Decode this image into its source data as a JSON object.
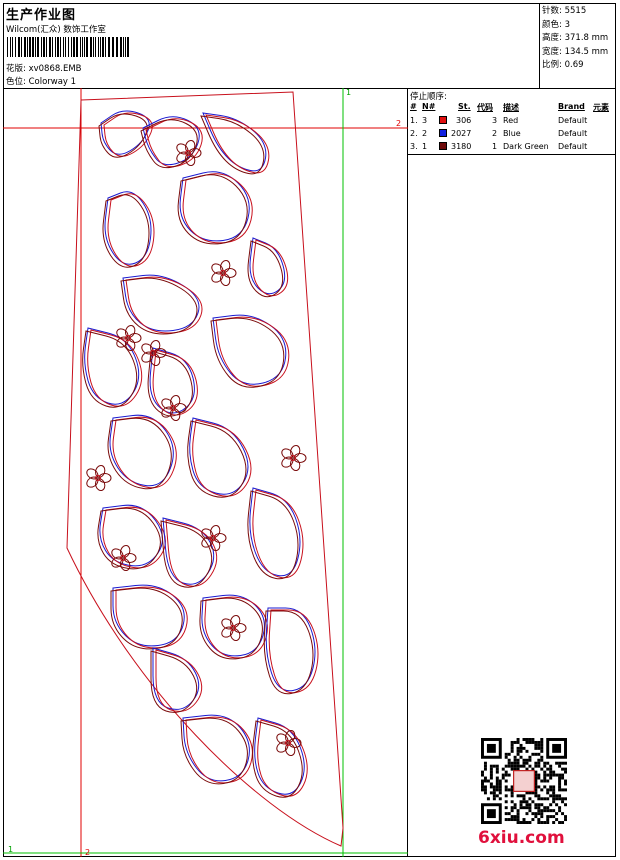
{
  "header": {
    "title": "生产作业图",
    "studio": "Wilcom(汇众) 数饰工作室",
    "file_label": "花版:",
    "file_name": "xv0868.EMB",
    "colorway_label": "色位:",
    "colorway_name": "Colorway 1"
  },
  "stats": [
    {
      "label": "针数",
      "value": "5515"
    },
    {
      "label": "颜色",
      "value": "3"
    },
    {
      "label": "高度",
      "value": "371.8 mm"
    },
    {
      "label": "宽度",
      "value": "134.5 mm"
    },
    {
      "label": "比例",
      "value": "0.69"
    }
  ],
  "stop_sequence": {
    "title": "停止顺序:",
    "columns": [
      "#",
      "N#",
      "St.",
      "代码",
      "描述",
      "Brand",
      "元素"
    ],
    "rows": [
      {
        "index": "1.",
        "needle": "3",
        "swatch": "#e01010",
        "stitches": "306",
        "code": "3",
        "description": "Red",
        "brand": "Default"
      },
      {
        "index": "2.",
        "needle": "2",
        "swatch": "#1020e0",
        "stitches": "2027",
        "code": "2",
        "description": "Blue",
        "brand": "Default"
      },
      {
        "index": "3.",
        "needle": "1",
        "swatch": "#6e0a0a",
        "stitches": "3180",
        "code": "1",
        "description": "Dark Green",
        "brand": "Default"
      }
    ]
  },
  "guides": {
    "vertical_label_top": "1",
    "horizontal_label_right": "2",
    "vertical_label_bottom": "2",
    "horizontal_label_left": "1"
  },
  "colors": {
    "red_thread": "#c8101c",
    "blue_thread": "#1a1ad0",
    "darkred_thread": "#7a0a0a",
    "guide_green": "#00c000",
    "guide_red": "#e00000"
  },
  "watermark": {
    "logo_text": "6xiu.com",
    "qr_icon": "qr-code-icon"
  }
}
